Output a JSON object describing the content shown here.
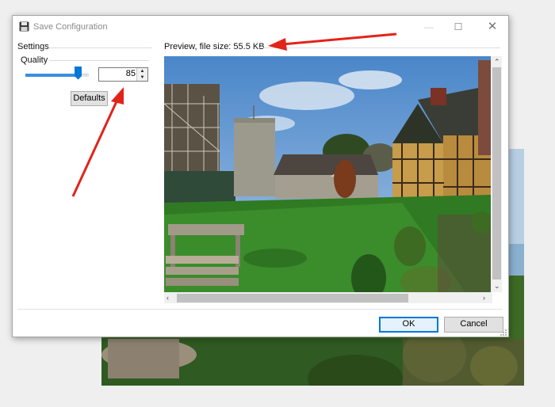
{
  "window": {
    "title": "Save Configuration",
    "icon": "floppy-disk-icon"
  },
  "settings": {
    "label": "Settings",
    "quality_label": "Quality",
    "quality_value": "85",
    "quality_level_percent": 85,
    "defaults_label": "Defaults"
  },
  "preview": {
    "label": "Preview, file size: 55.5 KB"
  },
  "buttons": {
    "ok": "OK",
    "cancel": "Cancel"
  },
  "colors": {
    "accent": "#0078d7",
    "annotation_arrow": "#e2231a"
  }
}
